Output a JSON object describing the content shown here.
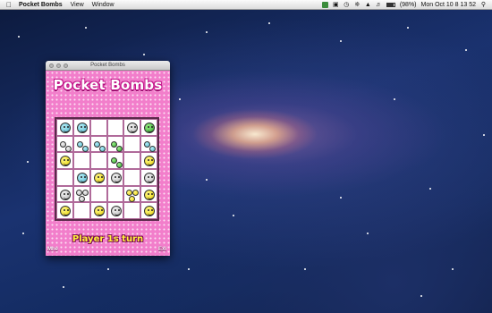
{
  "menubar": {
    "app_name": "Pocket Bombs",
    "items": [
      "View",
      "Window"
    ],
    "battery": "(98%)",
    "clock": "Mon Oct 10  8 13 52"
  },
  "window": {
    "title": "Pocket Bombs"
  },
  "game": {
    "logo": "Pocket Bombs",
    "turn": "Player 1s turn",
    "left_button": "Mne",
    "right_button": "Exi",
    "board": [
      [
        {
          "color": "blue",
          "count": 1
        },
        {
          "color": "blue",
          "count": 1
        },
        {
          "color": "",
          "count": 0
        },
        {
          "color": "",
          "count": 0
        },
        {
          "color": "grey",
          "count": 1
        },
        {
          "color": "green",
          "count": 1
        }
      ],
      [
        {
          "color": "grey",
          "count": 2
        },
        {
          "color": "blue",
          "count": 2
        },
        {
          "color": "blue",
          "count": 2
        },
        {
          "color": "green",
          "count": 2
        },
        {
          "color": "",
          "count": 0
        },
        {
          "color": "blue",
          "count": 2
        }
      ],
      [
        {
          "color": "yellow",
          "count": 1
        },
        {
          "color": "",
          "count": 0
        },
        {
          "color": "",
          "count": 0
        },
        {
          "color": "green",
          "count": 2
        },
        {
          "color": "",
          "count": 0
        },
        {
          "color": "yellow",
          "count": 1
        }
      ],
      [
        {
          "color": "",
          "count": 0
        },
        {
          "color": "blue",
          "count": 1
        },
        {
          "color": "yellow",
          "count": 1
        },
        {
          "color": "grey",
          "count": 1
        },
        {
          "color": "",
          "count": 0
        },
        {
          "color": "grey",
          "count": 1
        }
      ],
      [
        {
          "color": "grey",
          "count": 1
        },
        {
          "color": "grey",
          "count": 3
        },
        {
          "color": "",
          "count": 0
        },
        {
          "color": "",
          "count": 0
        },
        {
          "color": "yellow",
          "count": 3
        },
        {
          "color": "yellow",
          "count": 1
        }
      ],
      [
        {
          "color": "yellow",
          "count": 1
        },
        {
          "color": "",
          "count": 0
        },
        {
          "color": "yellow",
          "count": 1
        },
        {
          "color": "grey",
          "count": 1
        },
        {
          "color": "",
          "count": 0
        },
        {
          "color": "yellow",
          "count": 1
        }
      ]
    ]
  }
}
